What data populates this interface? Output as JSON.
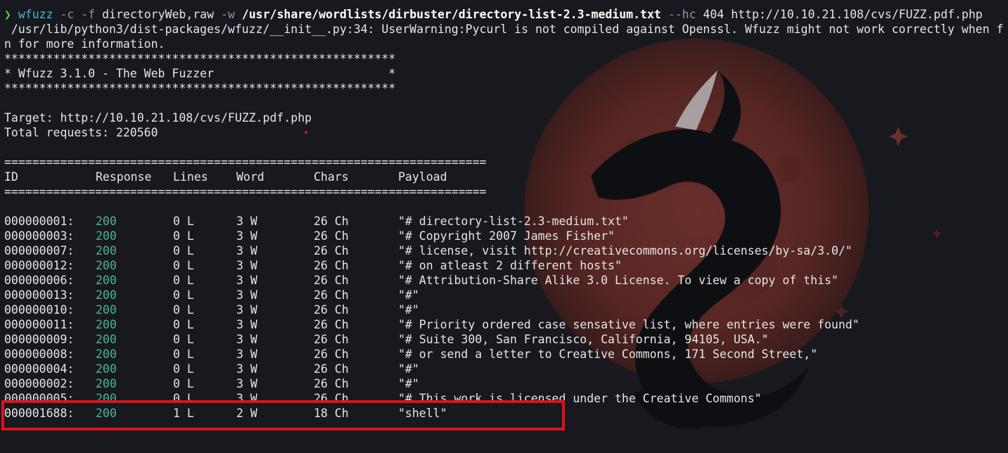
{
  "command": {
    "prompt_symbol": "❯",
    "program": "wfuzz",
    "flag_c": "-c",
    "flag_f": "-f",
    "output_arg": "directoryWeb,raw",
    "flag_w": "-w",
    "wordlist": "/usr/share/wordlists/dirbuster/directory-list-2.3-medium.txt",
    "flag_hc": "--hc",
    "hide_code": "404",
    "target_url": "http://10.10.21.108/cvs/FUZZ.pdf.php"
  },
  "warning": {
    "line1": " /usr/lib/python3/dist-packages/wfuzz/__init__.py:34: UserWarning:Pycurl is not compiled against Openssl. Wfuzz might not work correctly when f",
    "line2": "n for more information."
  },
  "banner": {
    "stars": "********************************************************",
    "title": "* Wfuzz 3.1.0 - The Web Fuzzer                         *"
  },
  "target_line": "Target: http://10.10.21.108/cvs/FUZZ.pdf.php",
  "total_line": "Total requests: 220560",
  "separator": "=====================================================================",
  "table": {
    "headers": [
      "ID",
      "Response",
      "Lines",
      "Word",
      "Chars",
      "Payload"
    ],
    "rows": [
      {
        "id": "000000001:",
        "response": "200",
        "lines": "0 L",
        "word": "3 W",
        "chars": "26 Ch",
        "payload": "\"# directory-list-2.3-medium.txt\""
      },
      {
        "id": "000000003:",
        "response": "200",
        "lines": "0 L",
        "word": "3 W",
        "chars": "26 Ch",
        "payload": "\"# Copyright 2007 James Fisher\""
      },
      {
        "id": "000000007:",
        "response": "200",
        "lines": "0 L",
        "word": "3 W",
        "chars": "26 Ch",
        "payload": "\"# license, visit http://creativecommons.org/licenses/by-sa/3.0/\""
      },
      {
        "id": "000000012:",
        "response": "200",
        "lines": "0 L",
        "word": "3 W",
        "chars": "26 Ch",
        "payload": "\"# on atleast 2 different hosts\""
      },
      {
        "id": "000000006:",
        "response": "200",
        "lines": "0 L",
        "word": "3 W",
        "chars": "26 Ch",
        "payload": "\"# Attribution-Share Alike 3.0 License. To view a copy of this\""
      },
      {
        "id": "000000013:",
        "response": "200",
        "lines": "0 L",
        "word": "3 W",
        "chars": "26 Ch",
        "payload": "\"#\""
      },
      {
        "id": "000000010:",
        "response": "200",
        "lines": "0 L",
        "word": "3 W",
        "chars": "26 Ch",
        "payload": "\"#\""
      },
      {
        "id": "000000011:",
        "response": "200",
        "lines": "0 L",
        "word": "3 W",
        "chars": "26 Ch",
        "payload": "\"# Priority ordered case sensative list, where entries were found\""
      },
      {
        "id": "000000009:",
        "response": "200",
        "lines": "0 L",
        "word": "3 W",
        "chars": "26 Ch",
        "payload": "\"# Suite 300, San Francisco, California, 94105, USA.\""
      },
      {
        "id": "000000008:",
        "response": "200",
        "lines": "0 L",
        "word": "3 W",
        "chars": "26 Ch",
        "payload": "\"# or send a letter to Creative Commons, 171 Second Street,\""
      },
      {
        "id": "000000004:",
        "response": "200",
        "lines": "0 L",
        "word": "3 W",
        "chars": "26 Ch",
        "payload": "\"#\""
      },
      {
        "id": "000000002:",
        "response": "200",
        "lines": "0 L",
        "word": "3 W",
        "chars": "26 Ch",
        "payload": "\"#\""
      },
      {
        "id": "000000005:",
        "response": "200",
        "lines": "0 L",
        "word": "3 W",
        "chars": "26 Ch",
        "payload": "\"# This work is licensed under the Creative Commons\""
      },
      {
        "id": "000001688:",
        "response": "200",
        "lines": "1 L",
        "word": "2 W",
        "chars": "18 Ch",
        "payload": "\"shell\""
      }
    ]
  },
  "colors": {
    "background": "#17191f",
    "prompt_green": "#59c94a",
    "command_blue": "#4fb1d9",
    "status_teal": "#4fb39a",
    "highlight_red": "#e0111a"
  },
  "wallpaper_icon": "dragon-moon-icon"
}
